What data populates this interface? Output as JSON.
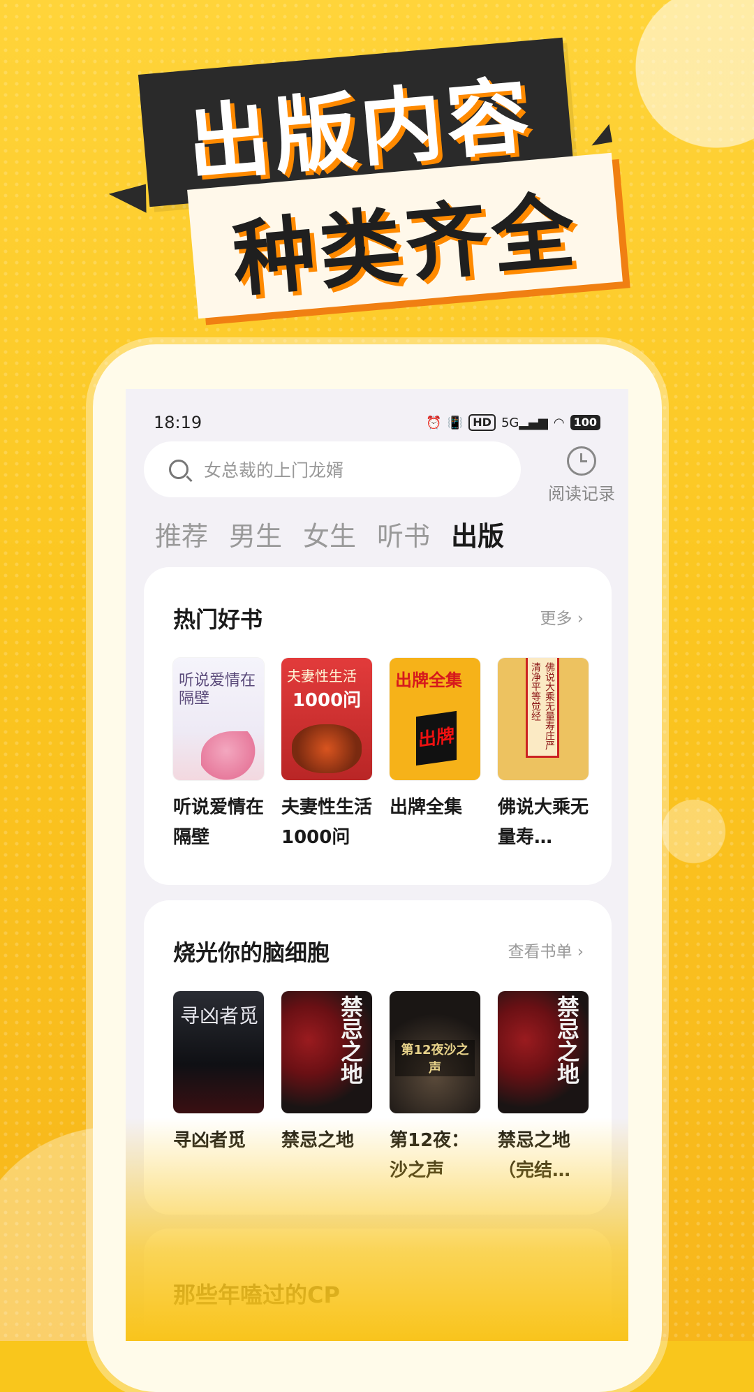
{
  "banner": {
    "line1": "出版内容",
    "line2": "种类齐全"
  },
  "status": {
    "time": "18:19",
    "hd": "HD",
    "net": "5G",
    "battery": "100"
  },
  "search": {
    "placeholder": "女总裁的上门龙婿"
  },
  "history": {
    "label": "阅读记录"
  },
  "tabs": [
    {
      "label": "推荐",
      "active": false
    },
    {
      "label": "男生",
      "active": false
    },
    {
      "label": "女生",
      "active": false
    },
    {
      "label": "听书",
      "active": false
    },
    {
      "label": "出版",
      "active": true
    }
  ],
  "section1": {
    "title": "热门好书",
    "more": "更多",
    "books": [
      {
        "title": "听说爱情在隔壁",
        "cover_text": "听说爱情在隔壁"
      },
      {
        "title": "夫妻性生活1000问",
        "cover_text": "夫妻性生活",
        "cover_num": "1000问"
      },
      {
        "title": "出牌全集",
        "cover_text": "出牌全集",
        "cover_mark": "出牌"
      },
      {
        "title": "佛说大乘无量寿…",
        "cover_text": "佛说大乘无量寿庄严清净平等觉经"
      }
    ]
  },
  "section2": {
    "title": "烧光你的脑细胞",
    "more": "查看书单",
    "books": [
      {
        "title": "寻凶者觅",
        "cover_text": "寻凶者觅"
      },
      {
        "title": "禁忌之地",
        "cover_text": "禁忌之地"
      },
      {
        "title": "第12夜：沙之声",
        "cover_text": "第12夜沙之声"
      },
      {
        "title": "禁忌之地（完结…",
        "cover_text": "禁忌之地"
      }
    ]
  },
  "section3": {
    "title": "那些年嗑过的CP"
  },
  "colors": {
    "background": "#f9c61c",
    "accent": "#ff8a00",
    "dark": "#2a2a2a"
  }
}
